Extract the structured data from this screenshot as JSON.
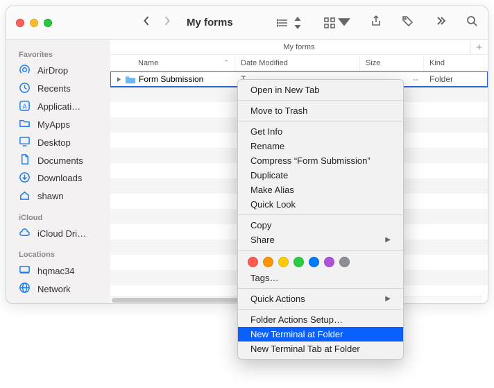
{
  "window": {
    "title": "My forms",
    "path_label": "My forms"
  },
  "sidebar": {
    "sections": [
      {
        "label": "Favorites",
        "items": [
          {
            "label": "AirDrop",
            "icon": "airdrop-icon"
          },
          {
            "label": "Recents",
            "icon": "clock-icon"
          },
          {
            "label": "Applicati…",
            "icon": "apps-icon"
          },
          {
            "label": "MyApps",
            "icon": "folder-icon"
          },
          {
            "label": "Desktop",
            "icon": "desktop-icon"
          },
          {
            "label": "Documents",
            "icon": "document-icon"
          },
          {
            "label": "Downloads",
            "icon": "downloads-icon"
          },
          {
            "label": "shawn",
            "icon": "home-icon"
          }
        ]
      },
      {
        "label": "iCloud",
        "items": [
          {
            "label": "iCloud Dri…",
            "icon": "cloud-icon"
          }
        ]
      },
      {
        "label": "Locations",
        "items": [
          {
            "label": "hqmac34",
            "icon": "computer-icon"
          },
          {
            "label": "Network",
            "icon": "network-icon"
          }
        ]
      }
    ]
  },
  "columns": {
    "name": "Name",
    "date": "Date Modified",
    "size": "Size",
    "kind": "Kind"
  },
  "rows": [
    {
      "name": "Form Submission",
      "date": "T",
      "size": "--",
      "kind": "Folder"
    }
  ],
  "context_menu": {
    "groups": [
      [
        "Open in New Tab"
      ],
      [
        "Move to Trash"
      ],
      [
        "Get Info",
        "Rename",
        "Compress “Form Submission”",
        "Duplicate",
        "Make Alias",
        "Quick Look"
      ],
      [
        "Copy",
        {
          "label": "Share",
          "submenu": true
        }
      ]
    ],
    "tag_colors": [
      "#ff5a52",
      "#ff9500",
      "#ffcc00",
      "#28cd41",
      "#007aff",
      "#af52de",
      "#8e8e93"
    ],
    "after_tags": [
      "Tags…"
    ],
    "quick_actions": {
      "label": "Quick Actions",
      "submenu": true
    },
    "final_group": [
      "Folder Actions Setup…",
      "New Terminal at Folder",
      "New Terminal Tab at Folder"
    ],
    "highlighted": "New Terminal at Folder"
  }
}
